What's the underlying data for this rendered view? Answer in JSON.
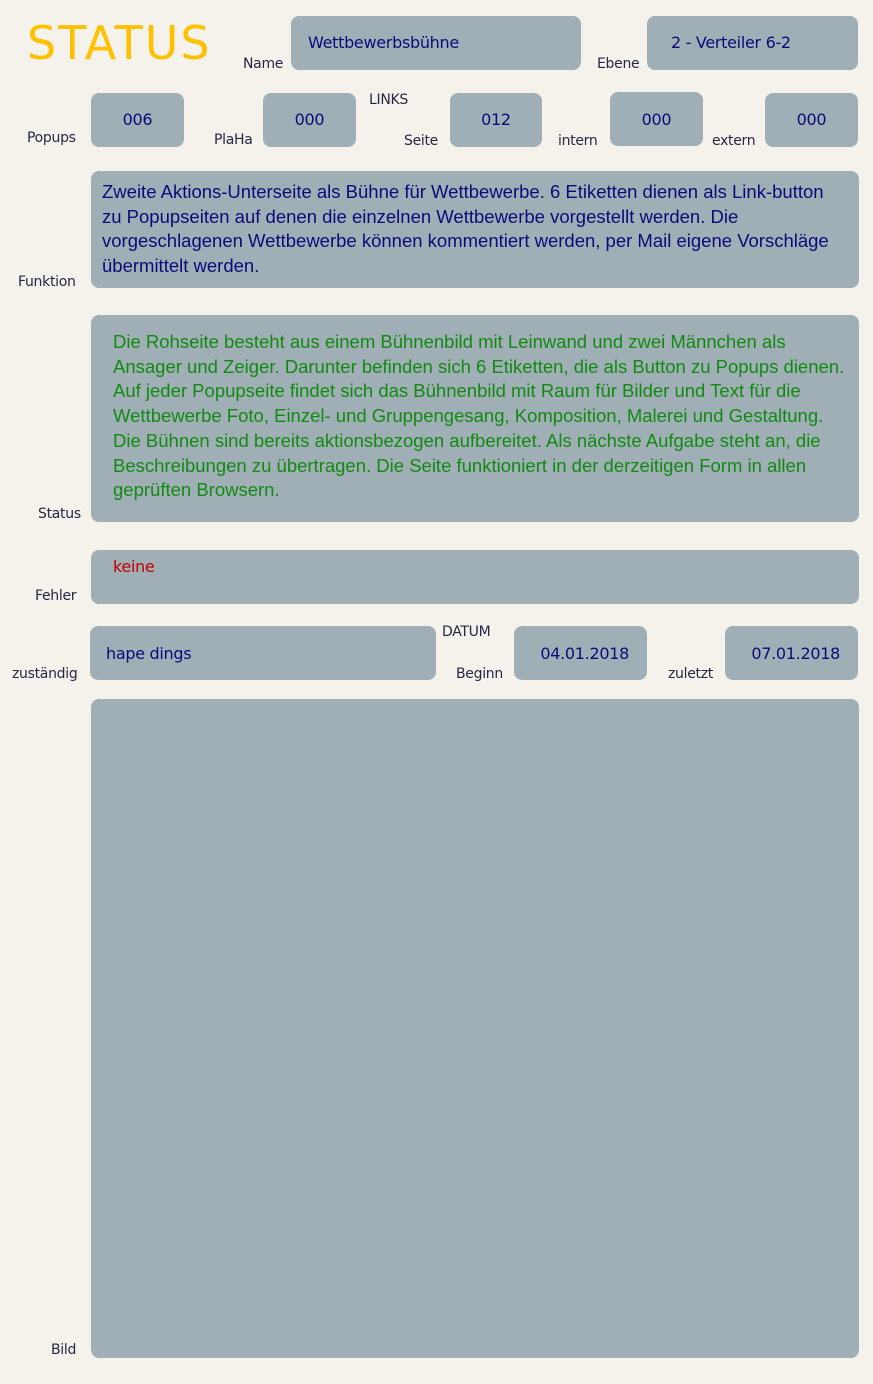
{
  "header": {
    "title": "STATUS",
    "title_color": "#ffc000"
  },
  "fields": {
    "name": {
      "label": "Name",
      "value": "Wettbewerbsbühne"
    },
    "ebene": {
      "label": "Ebene",
      "value": "2 - Verteiler 6-2"
    },
    "popups": {
      "label": "Popups",
      "value": "006"
    },
    "plaha": {
      "label": "PlaHa",
      "value": "000"
    },
    "links_heading": "LINKS",
    "seite": {
      "label": "Seite",
      "value": "012"
    },
    "intern": {
      "label": "intern",
      "value": "000"
    },
    "extern": {
      "label": "extern",
      "value": "000"
    },
    "funktion": {
      "label": "Funktion",
      "value": "Zweite Aktions-Unterseite als Bühne für Wettbewerbe. 6 Etiketten dienen als Link-button zu Popupseiten auf denen die einzelnen Wettbewerbe vorgestellt werden. Die vorgeschlagenen Wettbewerbe können kommentiert werden, per Mail eigene Vorschläge übermittelt werden.",
      "color": "#0a0a7a"
    },
    "status": {
      "label": "Status",
      "value": "Die Rohseite besteht aus einem Bühnenbild mit Leinwand und zwei Männchen als Ansager und Zeiger. Darunter befinden sich 6 Etiketten, die als Button zu Popups dienen. Auf jeder Popupseite findet sich das Bühnenbild mit Raum für Bilder und Text für die Wettbewerbe Foto, Einzel- und Gruppengesang, Komposition, Malerei und Gestaltung. Die Bühnen sind bereits aktionsbezogen aufbereitet. Als nächste Aufgabe steht an, die Beschreibungen zu übertragen. Die Seite funktioniert in der derzeitigen Form in allen geprüften Browsern.",
      "color": "#118a11"
    },
    "fehler": {
      "label": "Fehler",
      "value": "keine",
      "color": "#c00000"
    },
    "zustaendig": {
      "label": "zuständig",
      "value": "hape dings"
    },
    "datum_heading": "DATUM",
    "beginn": {
      "label": "Beginn",
      "value": "04.01.2018"
    },
    "zuletzt": {
      "label": "zuletzt",
      "value": "07.01.2018"
    },
    "bild": {
      "label": "Bild"
    }
  },
  "colors": {
    "background": "#f5f2ec",
    "box": "#a0afb6",
    "label": "#262645",
    "value": "#0a0a7a"
  }
}
